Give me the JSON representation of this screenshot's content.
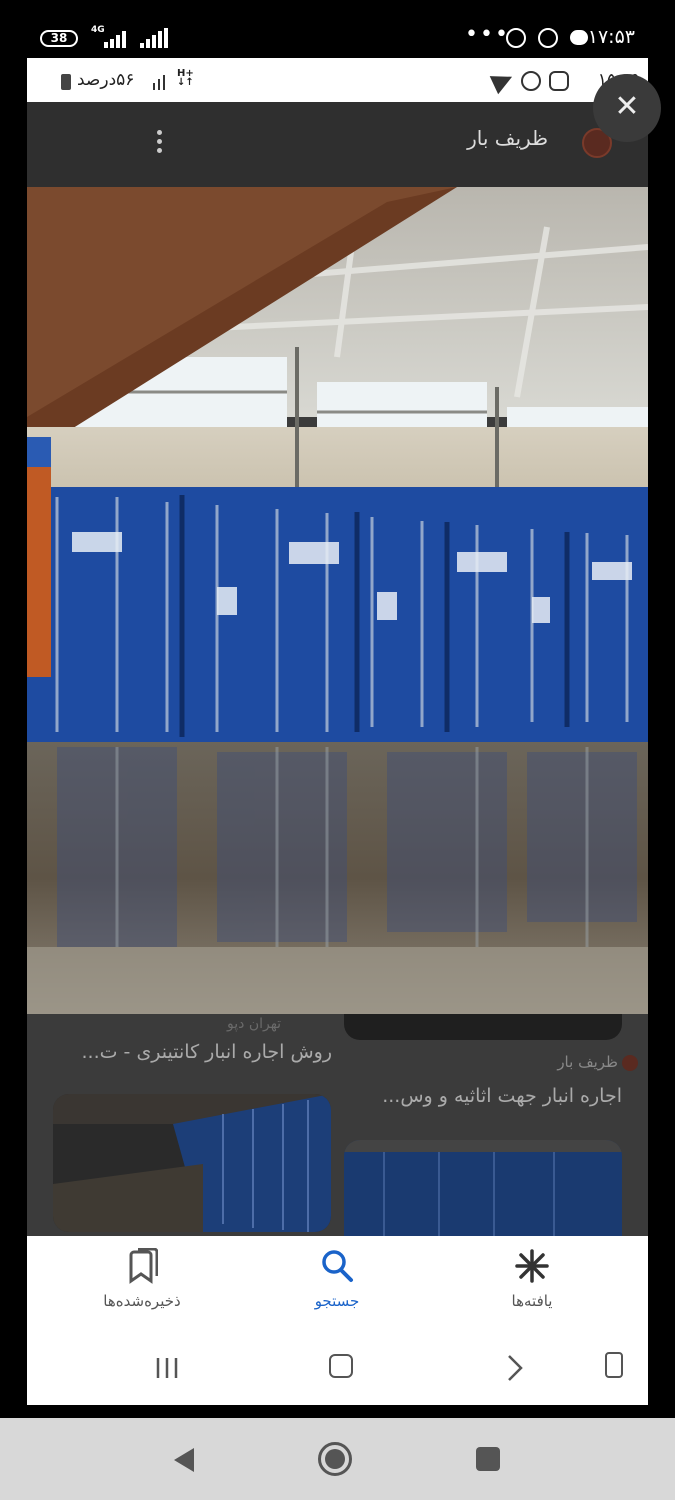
{
  "outer_status": {
    "battery": "38",
    "network": "4G",
    "time": "۱۷:۵۳",
    "dots": "•••"
  },
  "inner_status": {
    "time": "۱۵:۱۹",
    "battery": "۵۶درصد"
  },
  "app_header": {
    "title": "ظریف بار"
  },
  "feed": {
    "left_card_subtitle": "تهران دپو",
    "left_card_title": "روش اجاره انبار کانتینری - ت...",
    "right_card_source": "ظریف بار",
    "right_card_title": "اجاره انبار جهت اثاثیه و وس..."
  },
  "bottom_nav": {
    "items": [
      {
        "label": "ذخیره‌شده‌ها",
        "icon": "bookmark-icon"
      },
      {
        "label": "جستجو",
        "icon": "search-icon",
        "active": true
      },
      {
        "label": "یافته‌ها",
        "icon": "asterisk-icon"
      }
    ]
  },
  "colors": {
    "accent": "#1a63c9",
    "container_blue": "#1f4fa8"
  },
  "close_symbol": "✕"
}
